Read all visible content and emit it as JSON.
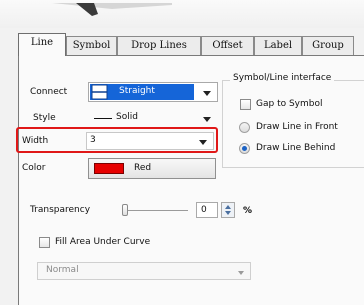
{
  "tabs": [
    {
      "label": "Line",
      "active": true
    },
    {
      "label": "Symbol"
    },
    {
      "label": "Drop Lines"
    },
    {
      "label": "Offset"
    },
    {
      "label": "Label"
    },
    {
      "label": "Group"
    }
  ],
  "line": {
    "connect_label": "Connect",
    "connect_value": "Straight",
    "style_label": "Style",
    "style_value": "Solid",
    "width_label": "Width",
    "width_value": "3",
    "color_label": "Color",
    "color_value": "Red",
    "color_hex": "#e60000"
  },
  "interface": {
    "title": "Symbol/Line interface",
    "gap_to_symbol": "Gap to Symbol",
    "draw_front": "Draw Line in Front",
    "draw_behind": "Draw Line Behind",
    "selected": "Draw Line Behind"
  },
  "transparency": {
    "label": "Transparency",
    "value": "0",
    "unit": "%"
  },
  "fill": {
    "label": "Fill Area Under Curve",
    "mode_value": "Normal"
  },
  "colors": {
    "highlight": "#e01818",
    "selection": "#1565d8"
  }
}
